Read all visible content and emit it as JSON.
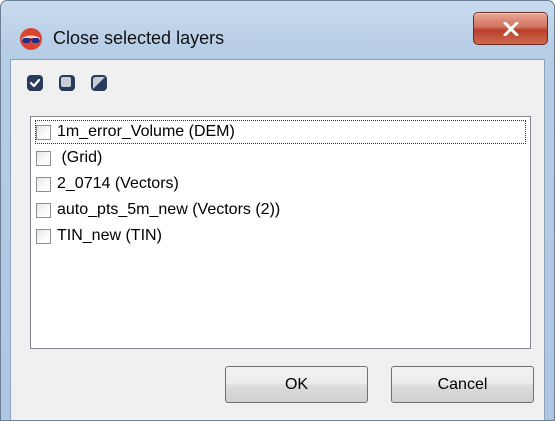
{
  "window": {
    "title": "Close selected layers",
    "close_icon": "close-x-icon",
    "app_icon": "glasses-icon"
  },
  "toolbar": {
    "buttons": [
      {
        "name": "check-all",
        "icon": "checkbox-checked-icon"
      },
      {
        "name": "uncheck-all",
        "icon": "checkbox-unchecked-icon"
      },
      {
        "name": "invert-selection",
        "icon": "checkbox-invert-icon"
      }
    ]
  },
  "layers": [
    {
      "label": "1m_error_Volume (DEM)",
      "checked": false
    },
    {
      "label": " (Grid)",
      "checked": false
    },
    {
      "label": "2_0714 (Vectors)",
      "checked": false
    },
    {
      "label": "auto_pts_5m_new (Vectors (2))",
      "checked": false
    },
    {
      "label": "TIN_new (TIN)",
      "checked": false
    }
  ],
  "buttons": {
    "ok": "OK",
    "cancel": "Cancel"
  },
  "colors": {
    "toolbar_icon": "#2a3c5c",
    "close_button": "#c4503a"
  }
}
